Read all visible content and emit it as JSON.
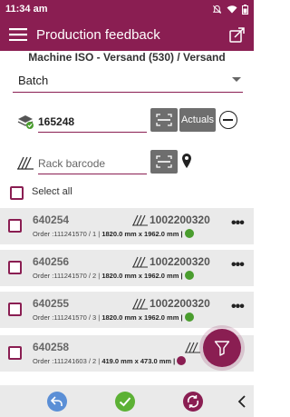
{
  "status_bar": {
    "time": "11:34 am"
  },
  "app_bar": {
    "title": "Production feedback"
  },
  "machine": {
    "label": "Machine ISO - Versand (530)   / Versand"
  },
  "mode_select": {
    "value": "Batch"
  },
  "batch_input": {
    "value": "165248"
  },
  "actuals_button": {
    "label": "Actuals"
  },
  "rack_input": {
    "placeholder": "Rack barcode"
  },
  "select_all": {
    "label": "Select all"
  },
  "items": [
    {
      "code": "640254",
      "barcode": "1002200320",
      "order": "Order :111241570 / 1 |",
      "dims": "1820.0 mm x 1962.0 mm |",
      "status": "done"
    },
    {
      "code": "640256",
      "barcode": "1002200320",
      "order": "Order :111241570 / 2 |",
      "dims": "1820.0 mm x 1962.0 mm |",
      "status": "done"
    },
    {
      "code": "640255",
      "barcode": "1002200320",
      "order": "Order :111241570 / 3 |",
      "dims": "1820.0 mm x 1962.0 mm |",
      "status": "done"
    },
    {
      "code": "640258",
      "barcode": "",
      "order": "Order :111241603 / 2 |",
      "dims": "419.0 mm x 473.0 mm |",
      "status": "in-progress"
    }
  ],
  "colors": {
    "brand": "#8a1e52",
    "ok": "#5cb135",
    "back": "#5b8fd6",
    "card": "#eaeaea"
  }
}
